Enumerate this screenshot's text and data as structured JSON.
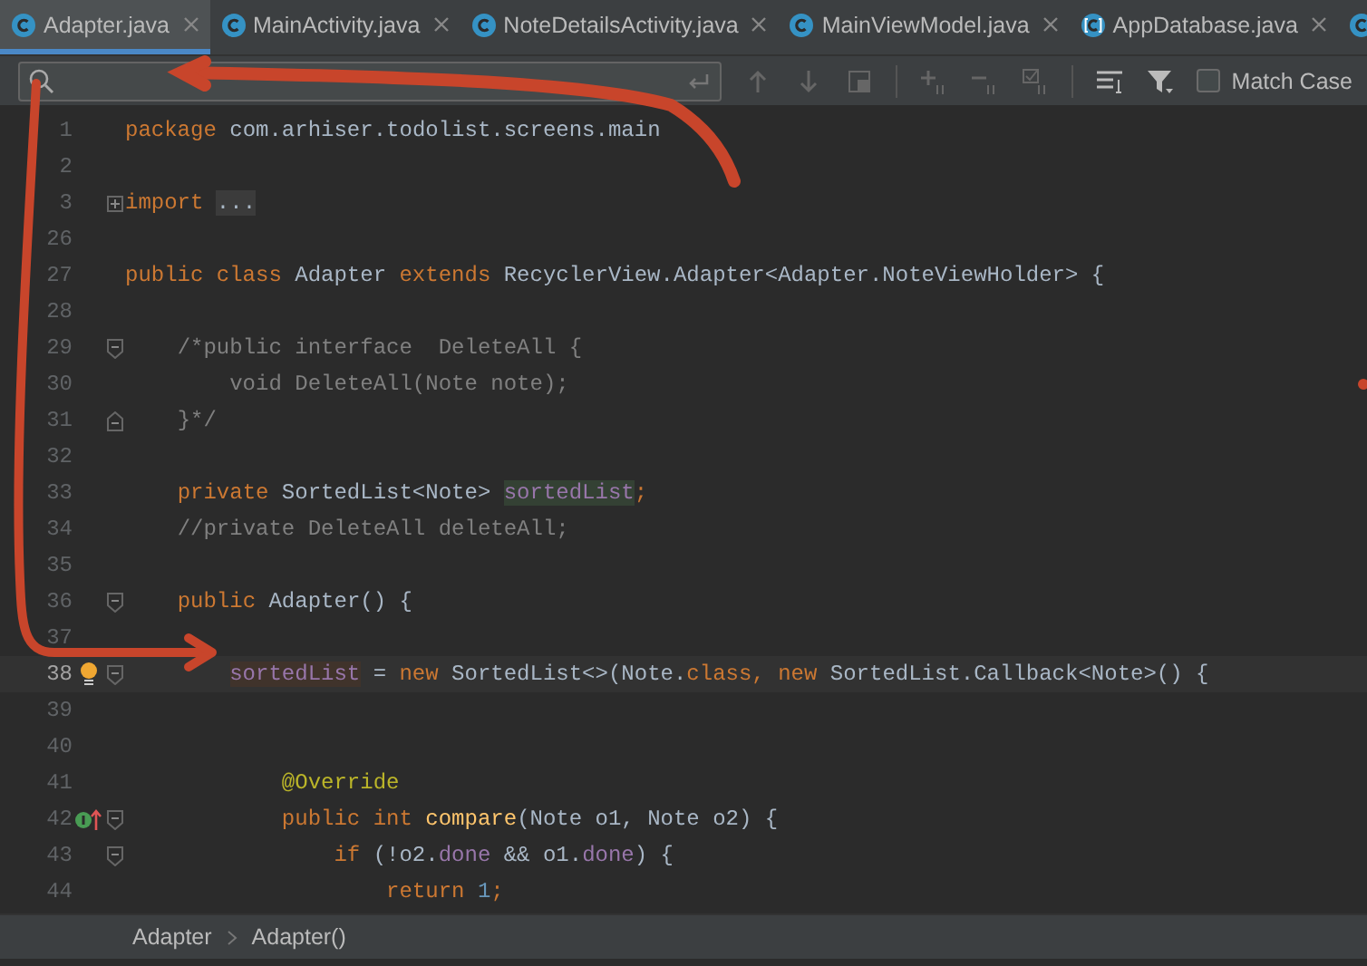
{
  "tabs": [
    {
      "label": "Adapter.java",
      "kind": "class",
      "selected": true
    },
    {
      "label": "MainActivity.java",
      "kind": "class",
      "selected": false
    },
    {
      "label": "NoteDetailsActivity.java",
      "kind": "class",
      "selected": false
    },
    {
      "label": "MainViewModel.java",
      "kind": "class",
      "selected": false
    },
    {
      "label": "AppDatabase.java",
      "kind": "abstract",
      "selected": false
    },
    {
      "kind": "class",
      "selected": false
    }
  ],
  "find_bar": {
    "match_case": {
      "label": "Match Case",
      "checked": false
    }
  },
  "editor": {
    "lines": [
      {
        "number": "1",
        "current": false,
        "segments": [
          {
            "kind": "keyword",
            "text": "package"
          },
          {
            "kind": "plain",
            "text": " com.arhiser.todolist.screens.main"
          }
        ]
      },
      {
        "number": "2",
        "current": false
      },
      {
        "number": "3",
        "current": false,
        "fold": {
          "kind": "collapsed"
        },
        "segments": [
          {
            "kind": "keyword",
            "text": "import "
          },
          {
            "kind": "folded",
            "text": "..."
          }
        ]
      },
      {
        "number": "26",
        "current": false
      },
      {
        "number": "27",
        "current": false,
        "segments": [
          {
            "kind": "keyword",
            "text": "public class "
          },
          {
            "kind": "plain",
            "text": "Adapter "
          },
          {
            "kind": "keyword",
            "text": "extends "
          },
          {
            "kind": "plain",
            "text": "RecyclerView.Adapter<Adapter.NoteViewHolder> {"
          }
        ]
      },
      {
        "number": "28",
        "current": false
      },
      {
        "number": "29",
        "current": false,
        "fold": {
          "kind": "start"
        },
        "segments": [
          {
            "kind": "comment",
            "text": "    /*public interface  DeleteAll {"
          }
        ]
      },
      {
        "number": "30",
        "current": false,
        "segments": [
          {
            "kind": "comment",
            "text": "        void DeleteAll(Note note);"
          }
        ]
      },
      {
        "number": "31",
        "current": false,
        "fold": {
          "kind": "end"
        },
        "segments": [
          {
            "kind": "comment",
            "text": "    }*/"
          }
        ]
      },
      {
        "number": "32",
        "current": false
      },
      {
        "number": "33",
        "current": false,
        "segments": [
          {
            "kind": "keyword",
            "text": "    private "
          },
          {
            "kind": "plain",
            "text": "SortedList<Note> "
          },
          {
            "kind": "field_read",
            "text": "sortedList"
          },
          {
            "kind": "keyword",
            "text": ";"
          }
        ]
      },
      {
        "number": "34",
        "current": false,
        "segments": [
          {
            "kind": "comment",
            "text": "    //private DeleteAll deleteAll;"
          }
        ]
      },
      {
        "number": "35",
        "current": false
      },
      {
        "number": "36",
        "current": false,
        "fold": {
          "kind": "start"
        },
        "segments": [
          {
            "kind": "keyword",
            "text": "    public "
          },
          {
            "kind": "plain",
            "text": "Adapter() {"
          }
        ]
      },
      {
        "number": "37",
        "current": false
      },
      {
        "number": "38",
        "current": true,
        "fold": {
          "kind": "start"
        },
        "marker": {
          "kind": "bulb"
        },
        "segments": [
          {
            "kind": "field_write",
            "text": "        sortedList"
          },
          {
            "kind": "plain",
            "text": " = "
          },
          {
            "kind": "keyword",
            "text": "new "
          },
          {
            "kind": "plain",
            "text": "SortedList<>(Note."
          },
          {
            "kind": "keyword",
            "text": "class, new "
          },
          {
            "kind": "plain",
            "text": "SortedList.Callback<Note>() {"
          }
        ]
      },
      {
        "number": "39",
        "current": false
      },
      {
        "number": "40",
        "current": false
      },
      {
        "number": "41",
        "current": false,
        "segments": [
          {
            "kind": "annotation",
            "text": "            @Override"
          }
        ]
      },
      {
        "number": "42",
        "current": false,
        "fold": {
          "kind": "start"
        },
        "marker": {
          "kind": "implements"
        },
        "segments": [
          {
            "kind": "keyword",
            "text": "            public int "
          },
          {
            "kind": "method",
            "text": "compare"
          },
          {
            "kind": "plain",
            "text": "(Note o1, Note o2) {"
          }
        ]
      },
      {
        "number": "43",
        "current": false,
        "fold": {
          "kind": "start"
        },
        "segments": [
          {
            "kind": "keyword",
            "text": "                if "
          },
          {
            "kind": "plain",
            "text": "(!o2."
          },
          {
            "kind": "field",
            "text": "done"
          },
          {
            "kind": "plain",
            "text": " && o1."
          },
          {
            "kind": "field",
            "text": "done"
          },
          {
            "kind": "plain",
            "text": ") {"
          }
        ]
      },
      {
        "number": "44",
        "current": false,
        "segments": [
          {
            "kind": "keyword",
            "text": "                    return "
          },
          {
            "kind": "number",
            "text": "1"
          },
          {
            "kind": "keyword",
            "text": ";"
          }
        ]
      }
    ]
  },
  "breadcrumbs": [
    "Adapter",
    "Adapter()"
  ]
}
